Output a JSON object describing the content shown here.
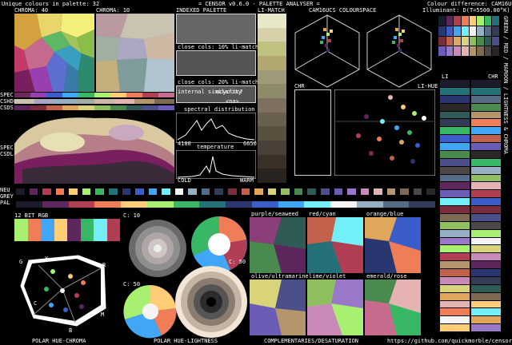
{
  "header": {
    "unique_colours": "Unique colours in palette: 32",
    "app_title": "= CENSOR v0.6.0 - PALETTE ANALYSER =",
    "colour_difference": "Colour difference: CAM16UCS",
    "illuminant": "Illuminant: D(T=5500.00°K)"
  },
  "sections": {
    "chroma_40": "CHROMA: 40",
    "chroma_10": "CHROMA: 10",
    "indexed_palette": "INDEXED PALETTE",
    "li_match": "LI-MATCH",
    "cam16ucs_colourspace": "CAM16UCS COLOURSPACE",
    "close_cols_10": "close cols: 10% li-match",
    "close_cols_20": "close cols: 20% li-match",
    "internal_similarity": "internal\nsimilarity",
    "acyclic": "acyclic?",
    "na": "<na>",
    "spectral_distribution": "spectral distribution",
    "spec_min": "4100",
    "spec_max": "6650",
    "temperature": "temperature",
    "cold": "COLD",
    "warm": "WARM",
    "spec_labels": [
      "SPEC",
      "CSHDL",
      "CSDS"
    ],
    "spec2_labels": [
      "SPEC",
      "CSDL"
    ],
    "neu": "NEU",
    "grey": "GREY",
    "pal": "PAL",
    "twelve_bit_rgb": "12 BIT RGB",
    "c10_a": "C: 10",
    "c50_a": "C: 50",
    "c50_b": "C: 50",
    "chr": "CHR",
    "li_hue": "LI-HUE",
    "li": "LI",
    "chr2": "CHR",
    "side_label": "GREEN / RED / MAROON / LIGHTNESS & CHROMA",
    "polar_hue_chroma": "POLAR HUE-CHROMA",
    "polar_hue_lightness": "POLAR HUE-LIGHTNESS",
    "complementaries": "COMPLEMENTARIES/DESATURATION",
    "github": "https://github.com/quickmorble/censor",
    "purple_seaweed": "purple/seaweed",
    "red_cyan": "red/cyan",
    "orange_blue": "orange/blue",
    "olive_ultramarine": "olive/ultramarine",
    "lime_violet": "lime/violet",
    "emerald_rose": "emerald/rose",
    "hue_letters": [
      "G",
      "Y",
      "R",
      "M",
      "B",
      "C"
    ]
  },
  "palette": [
    "#1a1c2c",
    "#5d275d",
    "#b13e53",
    "#ef7d57",
    "#ffcd75",
    "#a7f070",
    "#38b764",
    "#257179",
    "#29366f",
    "#3b5dc9",
    "#41a6f6",
    "#73eff7",
    "#f4f4f4",
    "#94b0c2",
    "#566c86",
    "#333c57",
    "#7a2e3d",
    "#c2614c",
    "#e0a75c",
    "#d9d47a",
    "#8fbf5e",
    "#4a8a4f",
    "#2f5a56",
    "#4b4f8a",
    "#6b5cb5",
    "#9a78c9",
    "#c98ab8",
    "#e6b3b3",
    "#b5956b",
    "#7d6a55",
    "#4d4845",
    "#2a2826"
  ],
  "colors": {
    "panel": "#1f3a33",
    "accent": "#ffffff"
  }
}
